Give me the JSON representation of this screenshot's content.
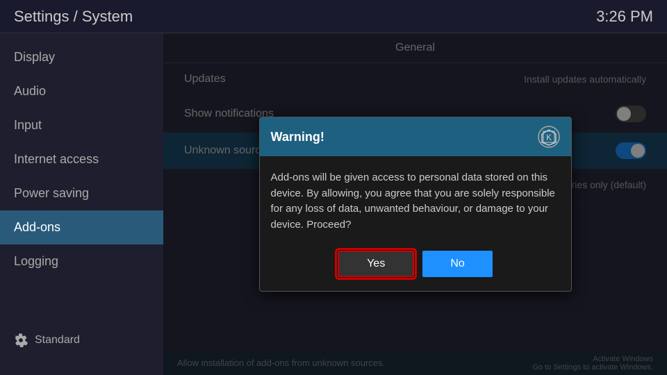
{
  "header": {
    "title": "Settings / System",
    "time": "3:26 PM"
  },
  "sidebar": {
    "items": [
      {
        "label": "Display",
        "active": false
      },
      {
        "label": "Audio",
        "active": false
      },
      {
        "label": "Input",
        "active": false
      },
      {
        "label": "Internet access",
        "active": false
      },
      {
        "label": "Power saving",
        "active": false
      },
      {
        "label": "Add-ons",
        "active": true
      },
      {
        "label": "Logging",
        "active": false
      }
    ],
    "footer_label": "Standard"
  },
  "content": {
    "section_label": "General",
    "rows": [
      {
        "label": "Updates",
        "value": "Install updates automatically",
        "type": "text"
      },
      {
        "label": "Show notifications",
        "value": "",
        "type": "toggle_off"
      },
      {
        "label": "Unknown sources",
        "value": "",
        "type": "toggle_on",
        "highlighted": true
      },
      {
        "label": "",
        "value": "Official repositories only (default)",
        "type": "text_right"
      }
    ]
  },
  "dialog": {
    "title": "Warning!",
    "body": "Add-ons will be given access to personal data stored on this device. By allowing, you agree that you are solely responsible for any loss of data, unwanted behaviour, or damage to your device. Proceed?",
    "yes_label": "Yes",
    "no_label": "No"
  },
  "statusbar": {
    "left": "Allow installation of add-ons from unknown sources.",
    "right_line1": "Activate Windows",
    "right_line2": "Go to Settings to activate Windows."
  }
}
